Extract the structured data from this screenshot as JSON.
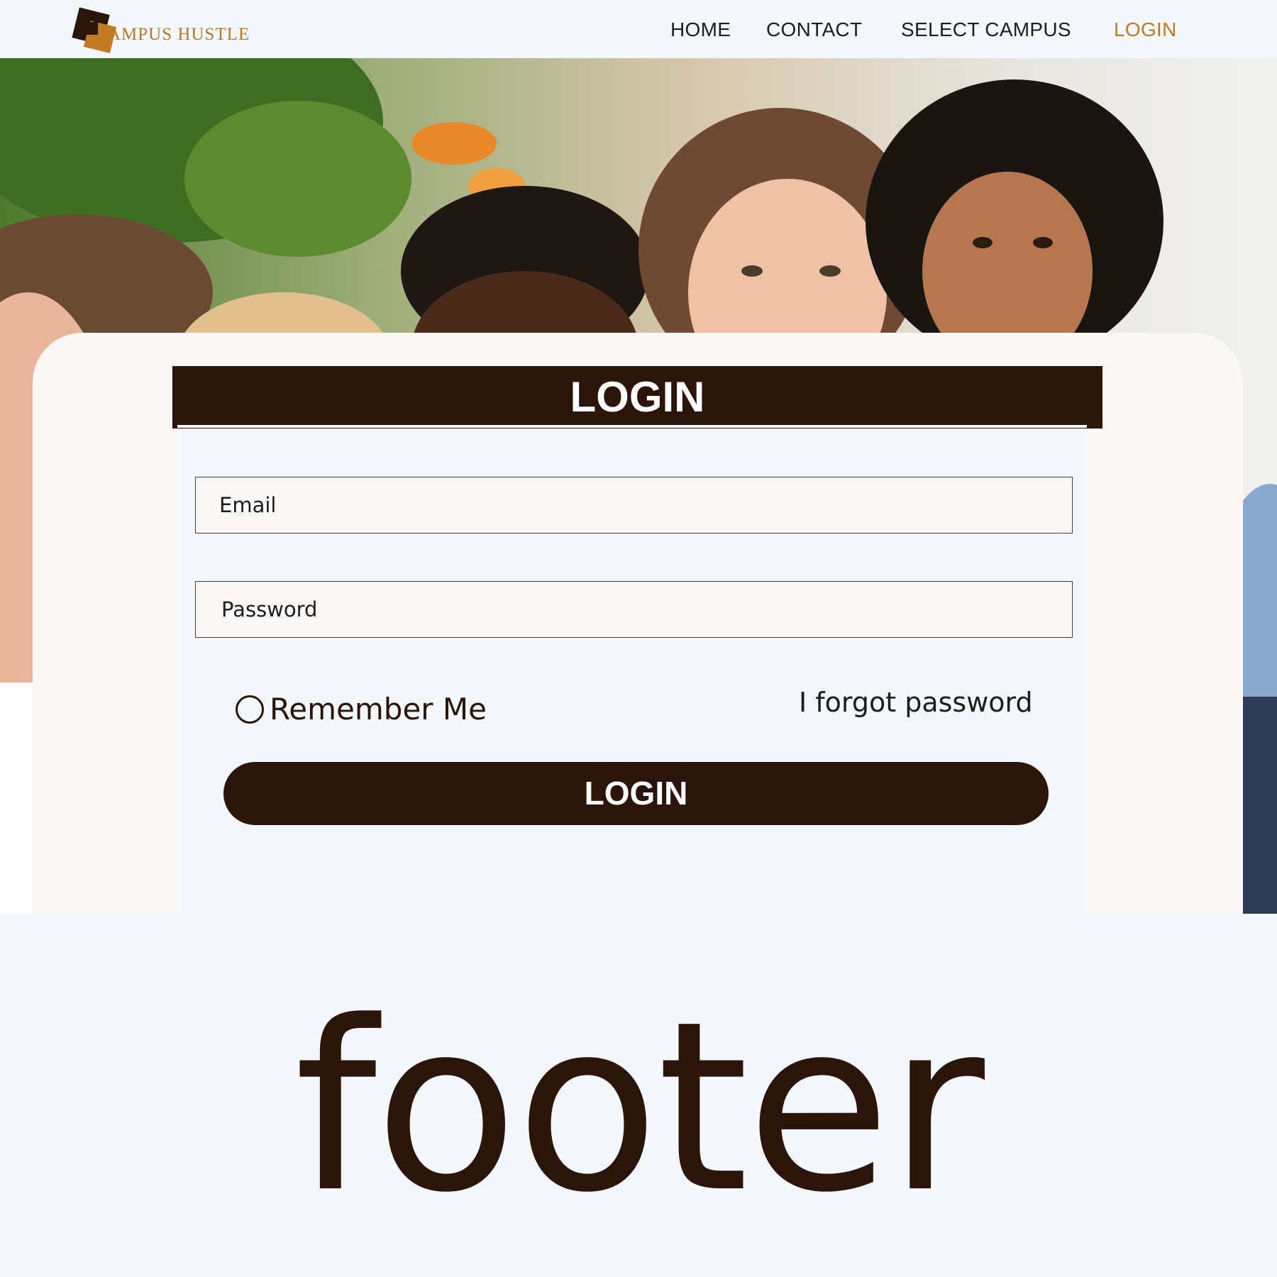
{
  "nav": {
    "logo_text": "AMPUS HUSTLE",
    "items": [
      {
        "label": "HOME"
      },
      {
        "label": "CONTACT"
      },
      {
        "label": "SELECT CAMPUS"
      },
      {
        "label": "LOGIN"
      }
    ]
  },
  "login": {
    "title": "LOGIN",
    "email_placeholder": "Email",
    "password_placeholder": "Password",
    "remember_label": "Remember Me",
    "forgot_label": "I forgot password",
    "button_label": "LOGIN"
  },
  "footer": {
    "text": "footer"
  },
  "colors": {
    "brand_dark": "#2b140a",
    "brand_accent": "#c07a22",
    "background": "#f4f7fb"
  }
}
